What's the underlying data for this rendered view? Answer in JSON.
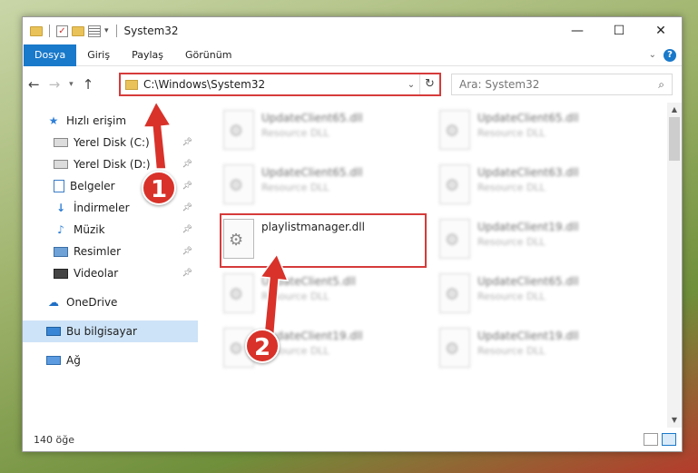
{
  "window": {
    "title": "System32"
  },
  "ribbon": {
    "tabs": [
      "Dosya",
      "Giriş",
      "Paylaş",
      "Görünüm"
    ],
    "help": "?"
  },
  "address": {
    "path": "C:\\Windows\\System32"
  },
  "search": {
    "placeholder": "Ara: System32"
  },
  "sidebar": {
    "items": [
      {
        "label": "Hızlı erişim",
        "icon": "star-icon"
      },
      {
        "label": "Yerel Disk (C:)",
        "icon": "disk-icon",
        "pinned": true
      },
      {
        "label": "Yerel Disk (D:)",
        "icon": "disk-icon",
        "pinned": true
      },
      {
        "label": "Belgeler",
        "icon": "documents-icon",
        "pinned": true
      },
      {
        "label": "İndirmeler",
        "icon": "downloads-icon",
        "pinned": true
      },
      {
        "label": "Müzik",
        "icon": "music-icon",
        "pinned": true
      },
      {
        "label": "Resimler",
        "icon": "pictures-icon",
        "pinned": true
      },
      {
        "label": "Videolar",
        "icon": "videos-icon",
        "pinned": true
      },
      {
        "label": "OneDrive",
        "icon": "cloud-icon"
      },
      {
        "label": "Bu bilgisayar",
        "icon": "computer-icon",
        "selected": true
      },
      {
        "label": "Ağ",
        "icon": "network-icon"
      }
    ]
  },
  "files": [
    {
      "name": "UpdateClient65.dll",
      "type": "Resource DLL"
    },
    {
      "name": "UpdateClient65.dll",
      "type": "Resource DLL"
    },
    {
      "name": "UpdateClient65.dll",
      "type": "Resource DLL"
    },
    {
      "name": "UpdateClient63.dll",
      "type": "Resource DLL"
    },
    {
      "name": "playlistmanager.dll",
      "type": ""
    },
    {
      "name": "UpdateClient19.dll",
      "type": "Resource DLL"
    },
    {
      "name": "UpdateClient5.dll",
      "type": "Resource DLL"
    },
    {
      "name": "UpdateClient65.dll",
      "type": "Resource DLL"
    },
    {
      "name": "UpdateClient19.dll",
      "type": "Resource DLL"
    },
    {
      "name": "UpdateClient19.dll",
      "type": "Resource DLL"
    }
  ],
  "status": {
    "count": "140 öğe"
  },
  "annotations": {
    "step1": "1",
    "step2": "2",
    "color": "#d8322a"
  }
}
